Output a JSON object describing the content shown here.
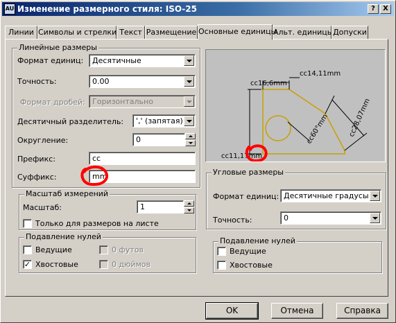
{
  "window": {
    "title": "Изменение размерного стиля: ISO-25",
    "icon_text": "AU",
    "help_btn": "?",
    "close_btn": "X"
  },
  "tabs": [
    "Линии",
    "Символы и стрелки",
    "Текст",
    "Размещение",
    "Основные единицы",
    "Альт. единицы",
    "Допуски"
  ],
  "active_tab": "Основные единицы",
  "linear": {
    "title": "Линейные размеры",
    "unit_format_label": "Формат единиц:",
    "unit_format_value": "Десятичные",
    "precision_label": "Точность:",
    "precision_value": "0.00",
    "fraction_label": "Формат дробей:",
    "fraction_value": "Горизонтально",
    "decimal_sep_label": "Десятичный разделитель:",
    "decimal_sep_value": "',' (запятая)",
    "round_label": "Округление:",
    "round_value": "0",
    "prefix_label": "Префикс:",
    "prefix_value": "cc",
    "suffix_label": "Суффикс:",
    "suffix_value": "mm"
  },
  "scale": {
    "title": "Масштаб измерений",
    "scale_label": "Масштаб:",
    "scale_value": "1",
    "layout_only_label": "Только для размеров на листе",
    "layout_only_checked": false
  },
  "zero_linear": {
    "title": "Подавление нулей",
    "leading_label": "Ведущие",
    "leading_checked": false,
    "trailing_label": "Хвостовые",
    "trailing_checked": true,
    "feet_label": "0 футов",
    "inches_label": "0 дюймов"
  },
  "preview": {
    "dim_top": "cc14,11mm",
    "dim_left_top": "cc16,6mm",
    "dim_left_bottom": "cc11,17mm",
    "dim_right": "cc28,07mm",
    "dim_radius": "cc60°mm"
  },
  "angular": {
    "title": "Угловые размеры",
    "unit_format_label": "Формат единиц:",
    "unit_format_value": "Десятичные градусы",
    "precision_label": "Точность:",
    "precision_value": "0"
  },
  "zero_angular": {
    "title": "Подавление нулей",
    "leading_label": "Ведущие",
    "leading_checked": false,
    "trailing_label": "Хвостовые",
    "trailing_checked": false
  },
  "buttons": {
    "ok": "OK",
    "cancel": "Отмена",
    "help": "Справка"
  },
  "colors": {
    "highlight_marker": "#ff0000",
    "preview_geometry": "#c8a000"
  }
}
